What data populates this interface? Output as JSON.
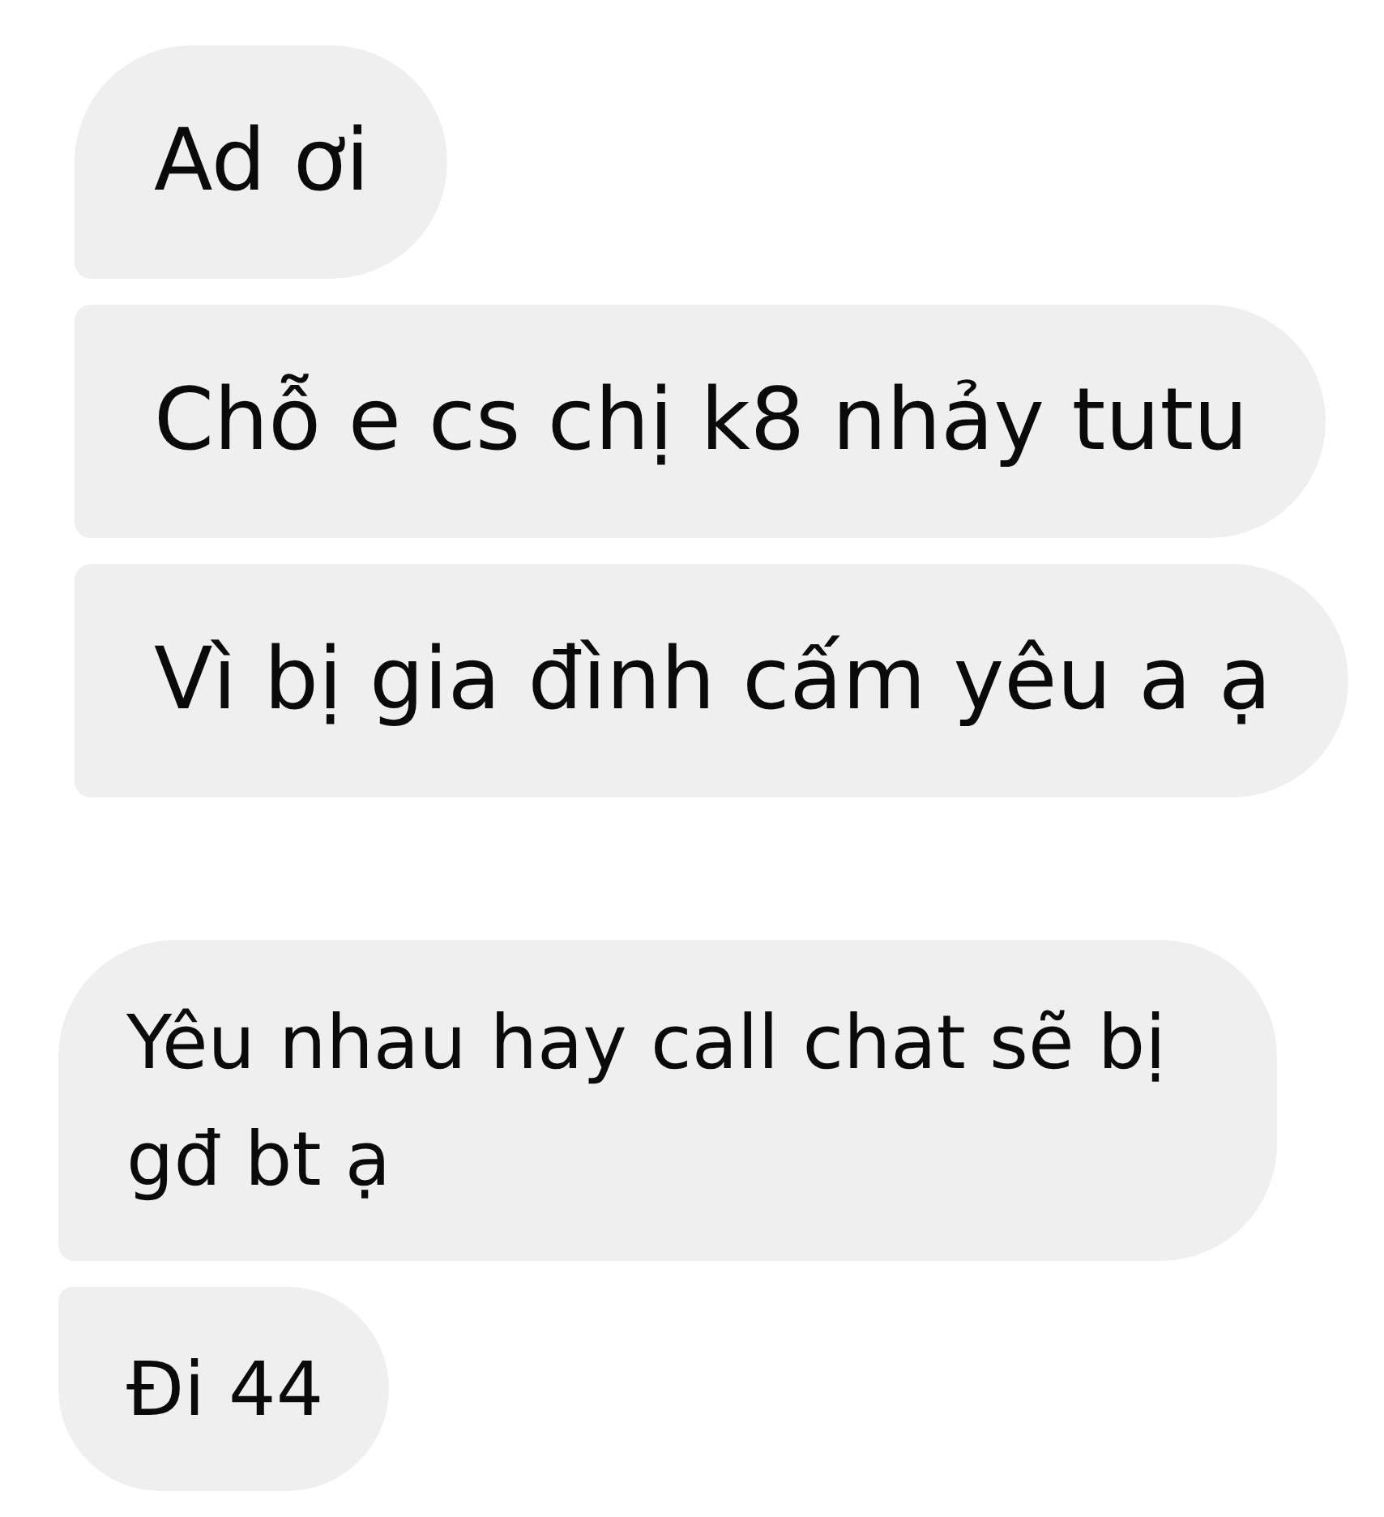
{
  "message_groups": [
    {
      "messages": [
        {
          "text": "Ad ơi"
        },
        {
          "text": "Chỗ e cs chị k8 nhảy tutu"
        },
        {
          "text": "Vì bị gia đình cấm yêu a ạ"
        }
      ]
    },
    {
      "messages": [
        {
          "text": "Yêu nhau hay call chat sẽ bị gđ bt ạ"
        },
        {
          "text": "Đi 44"
        }
      ]
    }
  ]
}
